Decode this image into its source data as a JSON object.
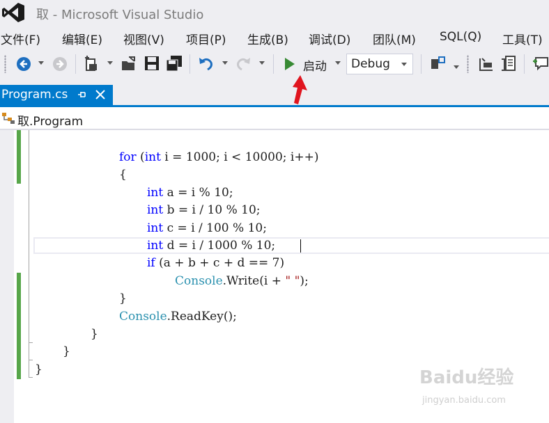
{
  "window": {
    "title": "取 - Microsoft Visual Studio"
  },
  "menu": {
    "items": [
      "文件(F)",
      "编辑(E)",
      "视图(V)",
      "项目(P)",
      "生成(B)",
      "调试(D)",
      "团队(M)",
      "SQL(Q)",
      "工具(T)"
    ]
  },
  "toolbar": {
    "start_label": "启动",
    "configuration": "Debug",
    "icons": [
      "back-icon",
      "forward-icon",
      "new-project-icon",
      "open-file-icon",
      "save-icon",
      "save-all-icon",
      "undo-icon",
      "redo-icon",
      "start-debug-icon",
      "find-icon",
      "step-icon",
      "comment-icon",
      "add-comment-icon"
    ]
  },
  "tabs": {
    "active_file": "Program.cs"
  },
  "navigation": {
    "class_name": "取.Program"
  },
  "editor": {
    "lines": [
      {
        "indent": "            ",
        "tokens": [
          {
            "t": "for",
            "c": "kw"
          },
          {
            "t": " ("
          },
          {
            "t": "int",
            "c": "kw"
          },
          {
            "t": " i = 1000; i < 10000; i++)"
          }
        ]
      },
      {
        "indent": "            ",
        "tokens": [
          {
            "t": "{"
          }
        ]
      },
      {
        "indent": "                ",
        "tokens": [
          {
            "t": "int",
            "c": "kw"
          },
          {
            "t": " a = i % 10;"
          }
        ]
      },
      {
        "indent": "                ",
        "tokens": [
          {
            "t": "int",
            "c": "kw"
          },
          {
            "t": " b = i / 10 % 10;"
          }
        ]
      },
      {
        "indent": "                ",
        "tokens": [
          {
            "t": "int",
            "c": "kw"
          },
          {
            "t": " c = i / 100 % 10;"
          }
        ]
      },
      {
        "indent": "                ",
        "tokens": [
          {
            "t": "int",
            "c": "kw"
          },
          {
            "t": " d = i / 1000 % 10;"
          }
        ]
      },
      {
        "indent": "                ",
        "tokens": [
          {
            "t": "if",
            "c": "kw"
          },
          {
            "t": " (a + b + c + d == 7)"
          }
        ]
      },
      {
        "indent": "                    ",
        "tokens": [
          {
            "t": "Console",
            "c": "ty"
          },
          {
            "t": ".Write(i + "
          },
          {
            "t": "\" \"",
            "c": "st"
          },
          {
            "t": ");"
          }
        ]
      },
      {
        "indent": "            ",
        "tokens": [
          {
            "t": "}"
          }
        ]
      },
      {
        "indent": "            ",
        "tokens": [
          {
            "t": "Console",
            "c": "ty"
          },
          {
            "t": ".ReadKey();"
          }
        ]
      },
      {
        "indent": "        ",
        "tokens": [
          {
            "t": "}"
          }
        ]
      },
      {
        "indent": "    ",
        "tokens": [
          {
            "t": "}"
          }
        ]
      },
      {
        "indent": "",
        "tokens": [
          {
            "t": "}"
          }
        ]
      }
    ]
  },
  "watermark": {
    "brand": "Baidu经验",
    "url": "jingyan.baidu.com"
  },
  "colors": {
    "accent": "#007acc",
    "change_marker": "#57a64a",
    "keyword": "#0000ff",
    "type": "#2b91af",
    "string": "#a31515",
    "annotation_arrow": "#e0141e"
  }
}
